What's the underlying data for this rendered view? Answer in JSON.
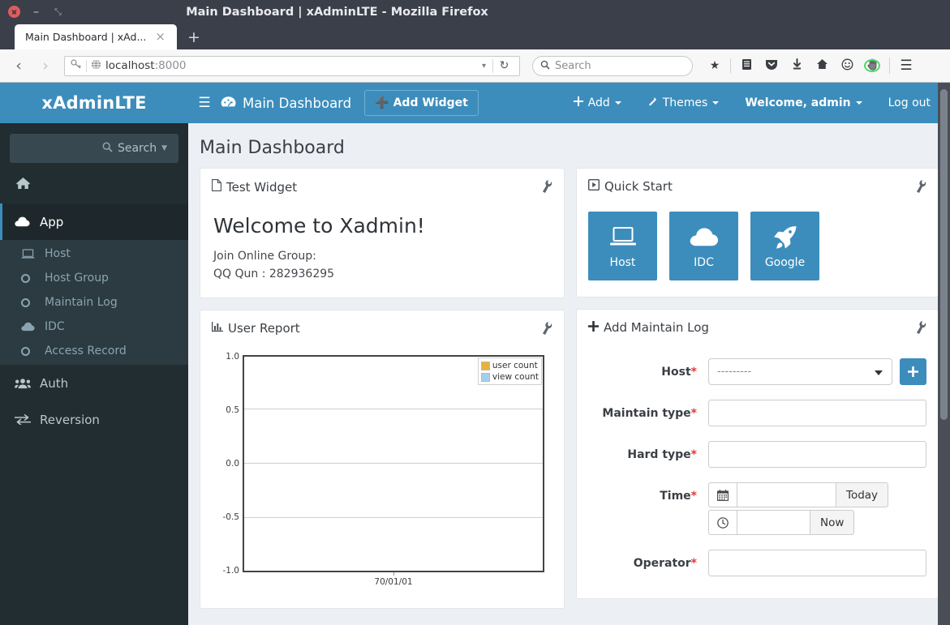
{
  "browser": {
    "window_title": "Main Dashboard | xAdminLTE - Mozilla Firefox",
    "tab_title": "Main Dashboard | xAd...",
    "tab_close_label": "×",
    "new_tab_label": "+",
    "back_label": "‹",
    "forward_label": "›",
    "url_host": "localhost",
    "url_port": ":8000",
    "reload_label": "↻",
    "search_placeholder": "Search",
    "window_close": "",
    "window_minimize": "–",
    "window_maximize": "⤡",
    "icons": {
      "key": "key-icon",
      "globe": "globe-icon",
      "star": "★",
      "library": "Ὅ3",
      "pocket": "pocket-icon",
      "download": "⬇",
      "home": "⌂",
      "sync": "☺",
      "container": "hand-icon",
      "menu": "☰"
    }
  },
  "sidebar": {
    "logo": "xAdminLTE",
    "search_label": "Search",
    "home_item": "home-icon",
    "items": [
      {
        "label": "App",
        "icon": "cloud-icon",
        "active": true
      },
      {
        "label": "Auth",
        "icon": "users-icon",
        "active": false
      },
      {
        "label": "Reversion",
        "icon": "exchange-icon",
        "active": false
      }
    ],
    "subitems": [
      {
        "label": "Host",
        "icon": "laptop-icon"
      },
      {
        "label": "Host Group",
        "icon": "circle-icon"
      },
      {
        "label": "Maintain Log",
        "icon": "circle-icon"
      },
      {
        "label": "IDC",
        "icon": "cloud-icon"
      },
      {
        "label": "Access Record",
        "icon": "circle-icon"
      }
    ]
  },
  "topnav": {
    "toggle": "☰",
    "brand": "Main Dashboard",
    "brand_icon": "dashboard-icon",
    "add_widget": "Add Widget",
    "right_links": [
      {
        "label": "Add",
        "icon": "plus-icon",
        "caret": true,
        "bold": false
      },
      {
        "label": "Themes",
        "icon": "magic-icon",
        "caret": true,
        "bold": false
      },
      {
        "label": "Welcome, admin",
        "icon": "",
        "caret": true,
        "bold": true
      },
      {
        "label": "Log out",
        "icon": "",
        "caret": false,
        "bold": false
      }
    ]
  },
  "page": {
    "title": "Main Dashboard"
  },
  "widgets": {
    "test_widget": {
      "title": "Test Widget",
      "icon": "file-icon",
      "tool_icon": "wrench-icon",
      "heading": "Welcome to Xadmin!",
      "line1": "Join Online Group:",
      "line2": "QQ Qun : 282936295"
    },
    "quick_start": {
      "title": "Quick Start",
      "icon": "play-box-icon",
      "tool_icon": "wrench-icon",
      "tiles": [
        {
          "label": "Host",
          "icon": "laptop-icon"
        },
        {
          "label": "IDC",
          "icon": "cloud-icon"
        },
        {
          "label": "Google",
          "icon": "rocket-icon"
        }
      ]
    },
    "user_report": {
      "title": "User Report",
      "icon": "bar-chart-icon",
      "tool_icon": "wrench-icon"
    },
    "add_maintain_log": {
      "title": "Add Maintain Log",
      "icon": "plus-icon",
      "tool_icon": "wrench-icon",
      "fields": {
        "host_label": "Host",
        "host_value": "---------",
        "host_add_button": "+",
        "maintain_type_label": "Maintain type",
        "maintain_type_value": "",
        "hard_type_label": "Hard type",
        "hard_type_value": "",
        "time_label": "Time",
        "date_value": "",
        "date_button": "Today",
        "date_icon": "calendar-icon",
        "time_value": "",
        "time_button": "Now",
        "time_icon": "clock-icon",
        "operator_label": "Operator",
        "operator_value": "",
        "required_marker": "*"
      }
    }
  },
  "chart_data": {
    "type": "bar",
    "title": "User Report",
    "categories": [
      "70/01/01"
    ],
    "series": [
      {
        "name": "user count",
        "values": [
          0
        ],
        "color": "#e8b23a"
      },
      {
        "name": "view count",
        "values": [
          0
        ],
        "color": "#a6cee8"
      }
    ],
    "x": [
      "70/01/01"
    ],
    "xlabel": "",
    "ylabel": "",
    "ylim": [
      -1.0,
      1.0
    ],
    "yticks": [
      1.0,
      0.5,
      0.0,
      -0.5,
      -1.0
    ],
    "ytick_labels": [
      "1.0",
      "0.5",
      "0.0",
      "-0.5",
      "-1.0"
    ],
    "xtick_labels": [
      "70/01/01"
    ],
    "grid": true,
    "legend_position": "top-right"
  },
  "colors": {
    "accent": "#3c8dbc",
    "sidebar_bg": "#222d32",
    "sidebar_sub_bg": "#2c3b41",
    "page_bg": "#ecf0f5",
    "required": "#e53935",
    "series_user_count": "#e8b23a",
    "series_view_count": "#a6cee8"
  }
}
